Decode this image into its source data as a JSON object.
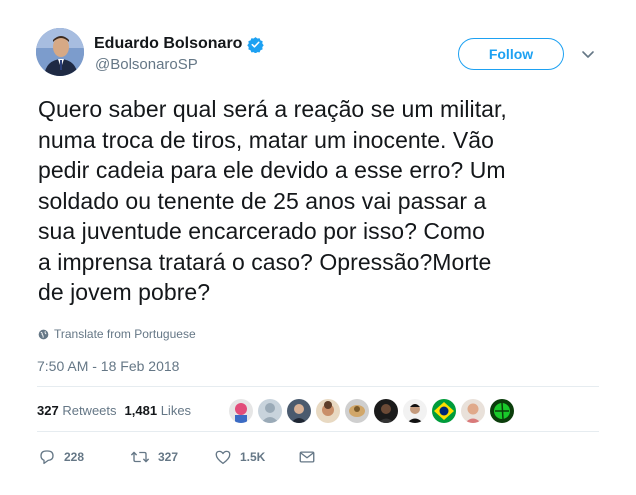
{
  "author": {
    "name": "Eduardo Bolsonaro",
    "handle": "@BolsonaroSP",
    "verified_color": "#1da1f2"
  },
  "follow_label": "Follow",
  "tweet_lines": [
    "Quero saber qual será a reação se um militar,",
    "numa troca de tiros, matar um inocente. Vão",
    "pedir cadeia para ele devido a esse erro? Um",
    "soldado ou tenente de 25 anos vai passar a",
    "sua juventude encarcerado por isso? Como",
    "a imprensa tratará o caso? Opressão?Morte",
    "de jovem pobre?"
  ],
  "translate_label": "Translate from Portuguese",
  "timestamp": "7:50 AM - 18 Feb 2018",
  "stats": {
    "retweets_count": "327",
    "retweets_label": "Retweets",
    "likes_count": "1,481",
    "likes_label": "Likes"
  },
  "actions": {
    "replies": "228",
    "retweets": "327",
    "likes": "1.5K"
  },
  "icons": {
    "globe": "globe-icon",
    "chevron": "chevron-down-icon",
    "reply": "reply-icon",
    "retweet": "retweet-icon",
    "like": "heart-icon",
    "dm": "envelope-icon"
  }
}
